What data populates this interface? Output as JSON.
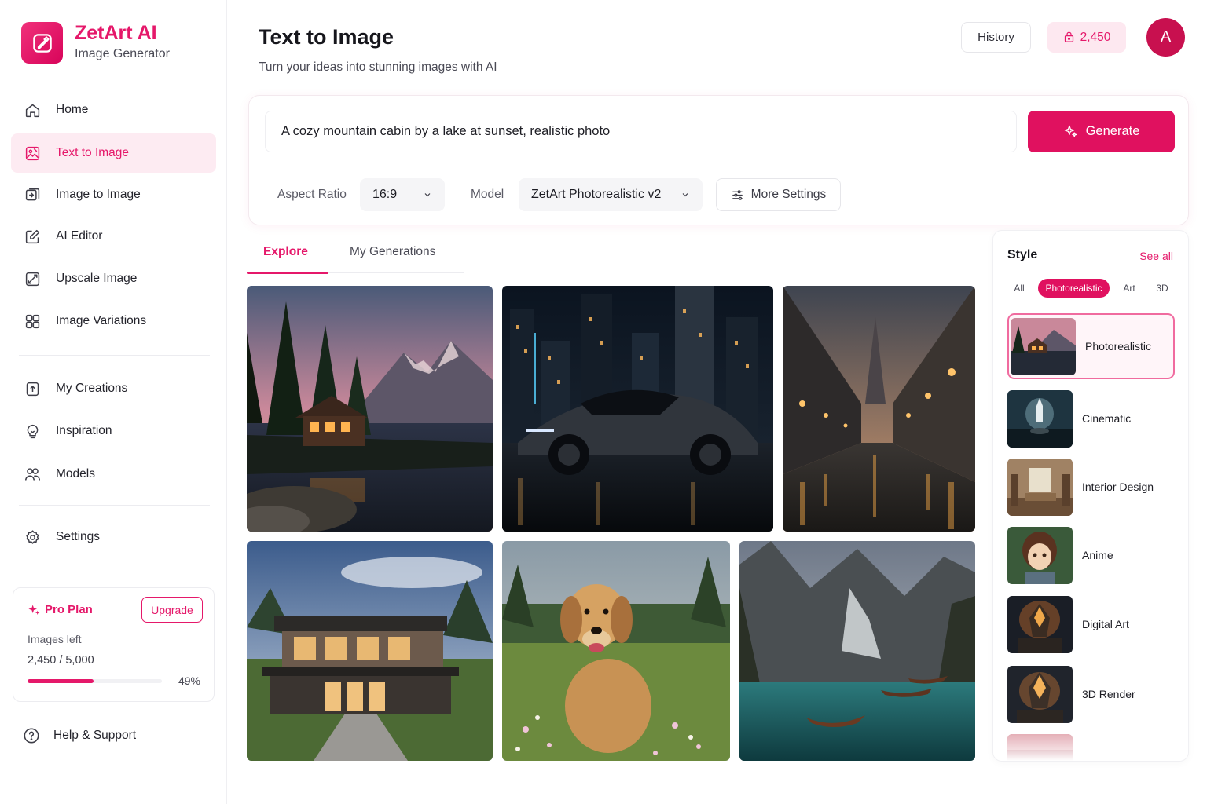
{
  "brand": {
    "name": "ZetArt AI",
    "subtitle": "Image Generator",
    "logo_icon": "magic-pen-icon",
    "color": "#e5186a"
  },
  "sidebar": {
    "items": [
      {
        "label": "Home",
        "icon": "home-icon",
        "active": false
      },
      {
        "label": "Text to Image",
        "icon": "text-to-image-icon",
        "active": true
      },
      {
        "label": "Image to Image",
        "icon": "image-to-image-icon",
        "active": false
      },
      {
        "label": "AI Editor",
        "icon": "edit-icon",
        "active": false
      },
      {
        "label": "Upscale Image",
        "icon": "upscale-icon",
        "active": false
      },
      {
        "label": "Image Variations",
        "icon": "variations-icon",
        "active": false
      },
      {
        "label": "My Creations",
        "icon": "creations-icon",
        "active": false
      },
      {
        "label": "Inspiration",
        "icon": "inspiration-icon",
        "active": false
      },
      {
        "label": "Models",
        "icon": "models-icon",
        "active": false
      },
      {
        "label": "Settings",
        "icon": "gear-icon",
        "active": false
      }
    ],
    "plan": {
      "title": "Pro Plan",
      "upgrade_label": "Upgrade",
      "images_left_label": "Images left",
      "count_text": "2,450 / 5,000",
      "percent_text": "49%",
      "progress": 0.49
    },
    "help_label": "Help & Support"
  },
  "header": {
    "title": "Text to Image",
    "subtitle": "Turn your ideas into stunning images with AI",
    "history_label": "History",
    "credits": "2,450",
    "avatar_initial": "A"
  },
  "prompt": {
    "value": "A cozy mountain cabin by a lake at sunset, realistic photo",
    "generate_label": "Generate",
    "aspect_label": "Aspect Ratio",
    "aspect_value": "16:9",
    "model_label": "Model",
    "model_value": "ZetArt Photorealistic v2",
    "more_settings_label": "More Settings"
  },
  "tabs": [
    {
      "label": "Explore",
      "active": true
    },
    {
      "label": "My Generations",
      "active": false
    }
  ],
  "gallery": [
    {
      "subject": "mountain cabin by a lake at sunset"
    },
    {
      "subject": "sports car in a neon city at night"
    },
    {
      "subject": "wet city street at dusk"
    },
    {
      "subject": "modern house with stone path"
    },
    {
      "subject": "golden retriever in a meadow"
    },
    {
      "subject": "alpine lake with boats"
    }
  ],
  "styles": {
    "title": "Style",
    "see_all_label": "See all",
    "filters": [
      {
        "label": "All",
        "active": false
      },
      {
        "label": "Photorealistic",
        "active": true
      },
      {
        "label": "Art",
        "active": false
      },
      {
        "label": "3D",
        "active": false
      }
    ],
    "items": [
      {
        "name": "Photorealistic",
        "active": true
      },
      {
        "name": "Cinematic",
        "active": false
      },
      {
        "name": "Interior Design",
        "active": false
      },
      {
        "name": "Anime",
        "active": false
      },
      {
        "name": "Digital Art",
        "active": false
      },
      {
        "name": "3D Render",
        "active": false
      }
    ]
  }
}
